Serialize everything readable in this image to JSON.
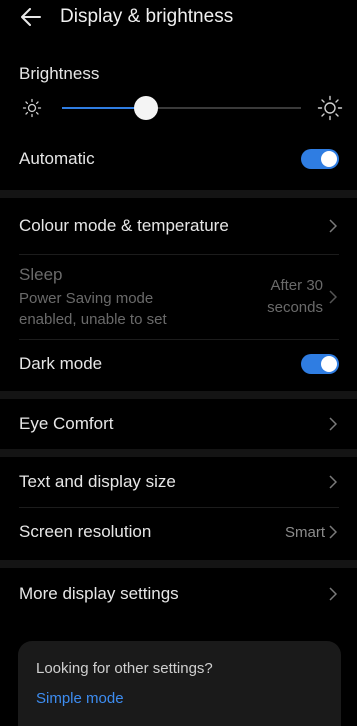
{
  "header": {
    "title": "Display & brightness",
    "back_icon": "back-arrow-icon"
  },
  "brightness": {
    "label": "Brightness",
    "level": 0.35,
    "accent": "#2f7de2"
  },
  "automatic": {
    "label": "Automatic",
    "on": true
  },
  "colour_mode": {
    "label": "Colour mode & temperature"
  },
  "sleep": {
    "title": "Sleep",
    "subtitle_line1": "Power Saving mode",
    "subtitle_line2": "enabled, unable to set",
    "value_line1": "After 30",
    "value_line2": "seconds"
  },
  "dark_mode": {
    "label": "Dark mode",
    "on": true
  },
  "eye_comfort": {
    "label": "Eye Comfort"
  },
  "text_size": {
    "label": "Text and display size"
  },
  "resolution": {
    "label": "Screen resolution",
    "value": "Smart"
  },
  "more_display": {
    "label": "More display settings"
  },
  "suggestion": {
    "question": "Looking for other settings?",
    "link": "Simple mode"
  }
}
